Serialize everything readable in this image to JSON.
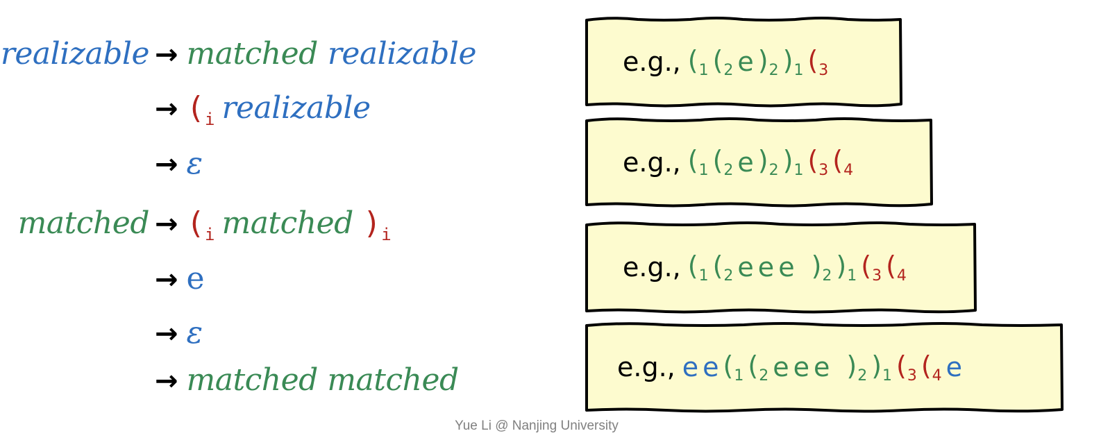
{
  "grammar": {
    "rules": [
      {
        "lhs": {
          "text": "realizable",
          "color": "blue"
        },
        "alternatives": [
          [
            {
              "kind": "nt",
              "text": "matched",
              "color": "green"
            },
            {
              "kind": "nt",
              "text": "realizable",
              "color": "blue"
            }
          ],
          [
            {
              "kind": "open",
              "text": "(",
              "sub": "i",
              "color": "red"
            },
            {
              "kind": "nt",
              "text": "realizable",
              "color": "blue"
            }
          ],
          [
            {
              "kind": "eps",
              "text": "ε",
              "color": "blue"
            }
          ]
        ]
      },
      {
        "lhs": {
          "text": "matched",
          "color": "green"
        },
        "alternatives": [
          [
            {
              "kind": "open",
              "text": "(",
              "sub": "i",
              "color": "red"
            },
            {
              "kind": "nt",
              "text": "matched",
              "color": "green"
            },
            {
              "kind": "close",
              "text": ")",
              "sub": "i",
              "color": "red"
            }
          ],
          [
            {
              "kind": "term",
              "text": "e",
              "color": "blue"
            }
          ],
          [
            {
              "kind": "eps",
              "text": "ε",
              "color": "blue"
            }
          ],
          [
            {
              "kind": "nt",
              "text": "matched matched",
              "color": "green"
            }
          ]
        ]
      }
    ],
    "arrow_symbol": "→"
  },
  "examples": [
    {
      "label": "e.g.,",
      "tokens": [
        {
          "text": "(",
          "sub": "1",
          "color": "green"
        },
        {
          "text": "(",
          "sub": "2",
          "color": "green"
        },
        {
          "text": "e",
          "color": "green"
        },
        {
          "text": ")",
          "sub": "2",
          "color": "green"
        },
        {
          "text": ")",
          "sub": "1",
          "color": "green"
        },
        {
          "text": "(",
          "sub": "3",
          "color": "red"
        }
      ]
    },
    {
      "label": "e.g.,",
      "tokens": [
        {
          "text": "(",
          "sub": "1",
          "color": "green"
        },
        {
          "text": "(",
          "sub": "2",
          "color": "green"
        },
        {
          "text": "e",
          "color": "green"
        },
        {
          "text": ")",
          "sub": "2",
          "color": "green"
        },
        {
          "text": ")",
          "sub": "1",
          "color": "green"
        },
        {
          "text": "(",
          "sub": "3",
          "color": "red"
        },
        {
          "text": "(",
          "sub": "4",
          "color": "red"
        }
      ]
    },
    {
      "label": "e.g.,",
      "tokens": [
        {
          "text": "(",
          "sub": "1",
          "color": "green"
        },
        {
          "text": "(",
          "sub": "2",
          "color": "green"
        },
        {
          "text": "e",
          "color": "green"
        },
        {
          "text": "e",
          "color": "green"
        },
        {
          "text": "e",
          "color": "green"
        },
        {
          "text": ")",
          "sub": "2",
          "color": "green",
          "gap": true
        },
        {
          "text": ")",
          "sub": "1",
          "color": "green"
        },
        {
          "text": "(",
          "sub": "3",
          "color": "red"
        },
        {
          "text": "(",
          "sub": "4",
          "color": "red"
        }
      ]
    },
    {
      "label": "e.g.,",
      "tokens": [
        {
          "text": "e",
          "color": "blue"
        },
        {
          "text": "e",
          "color": "blue"
        },
        {
          "text": "(",
          "sub": "1",
          "color": "green"
        },
        {
          "text": "(",
          "sub": "2",
          "color": "green"
        },
        {
          "text": "e",
          "color": "green"
        },
        {
          "text": "e",
          "color": "green"
        },
        {
          "text": "e",
          "color": "green"
        },
        {
          "text": ")",
          "sub": "2",
          "color": "green",
          "gap": true
        },
        {
          "text": ")",
          "sub": "1",
          "color": "green"
        },
        {
          "text": "(",
          "sub": "3",
          "color": "red"
        },
        {
          "text": "(",
          "sub": "4",
          "color": "red"
        },
        {
          "text": "e",
          "color": "blue"
        }
      ]
    }
  ],
  "footer": {
    "text": "Yue Li @ Nanjing University"
  },
  "colors": {
    "blue": "#2e6fc0",
    "green": "#3a8a55",
    "red": "#b3241e",
    "box_fill": "#fdfbcf",
    "footer_gray": "#808080"
  }
}
